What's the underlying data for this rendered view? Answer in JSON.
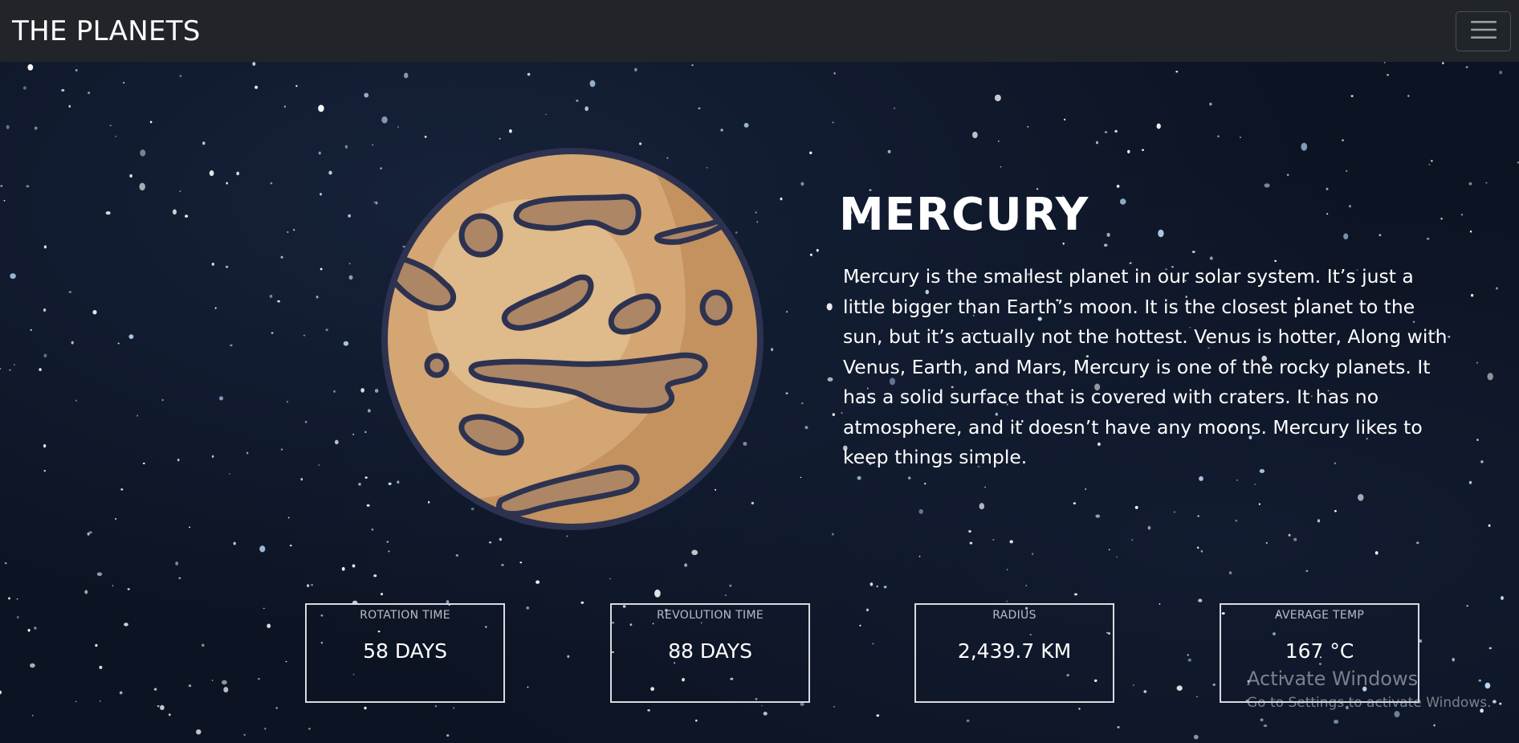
{
  "navbar": {
    "brand": "THE PLANETS",
    "toggle_icon": "hamburger-menu-icon"
  },
  "planet": {
    "name": "MERCURY",
    "illustration": "mercury-planet-icon",
    "colors": {
      "body": "#d4a673",
      "highlight": "#e0bb8c",
      "shadow": "#c08f5e",
      "outline": "#2d3250",
      "crater": "#ad8665"
    },
    "description": "Mercury is the smallest planet in our solar system. It’s just a little bigger than Earth’s moon. It is the closest planet to the sun, but it’s actually not the hottest. Venus is hotter, Along with Venus, Earth, and Mars, Mercury is one of the rocky planets. It has a solid surface that is covered with craters. It has no atmosphere, and it doesn’t have any moons. Mercury likes to keep things simple."
  },
  "stats": [
    {
      "label": "ROTATION TIME",
      "value": "58 DAYS"
    },
    {
      "label": "REVOLUTION TIME",
      "value": "88 DAYS"
    },
    {
      "label": "RADIUS",
      "value": "2,439.7 KM"
    },
    {
      "label": "AVERAGE TEMP",
      "value": "167 °C"
    }
  ],
  "watermark": {
    "title": "Activate Windows",
    "subtitle": "Go to Settings to activate Windows."
  },
  "theme": {
    "navbar_bg": "#212529",
    "sky_bg": "#0c1322",
    "text": "#ffffff"
  }
}
